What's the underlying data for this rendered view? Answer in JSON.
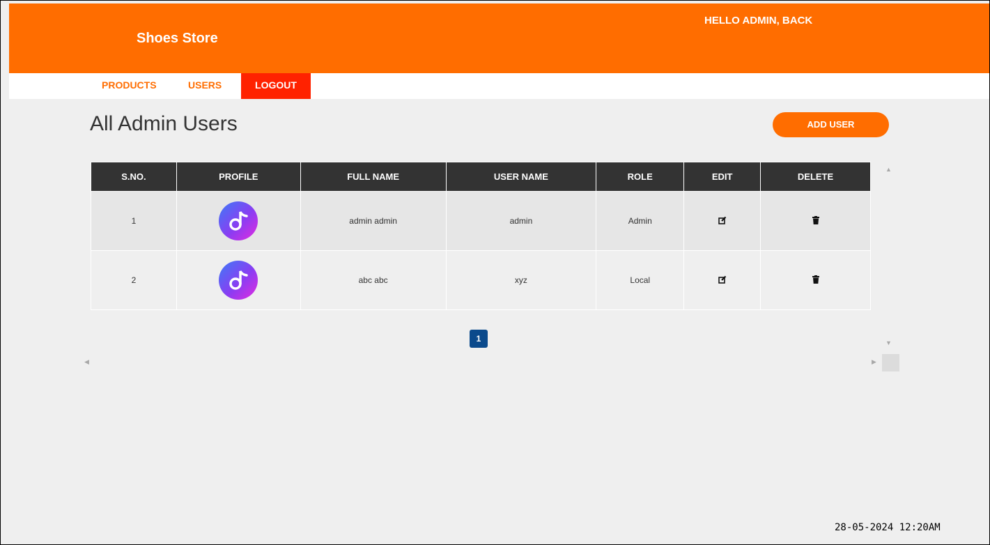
{
  "header": {
    "brand": "Shoes Store",
    "greeting": "HELLO ADMIN, BACK",
    "bg_color": "#ff6d00"
  },
  "nav": {
    "items": [
      {
        "label": "PRODUCTS",
        "active": false
      },
      {
        "label": "USERS",
        "active": false
      },
      {
        "label": "LOGOUT",
        "active": true
      }
    ],
    "accent_color": "#ff6d00",
    "logout_color": "#ff2200"
  },
  "page": {
    "title": "All Admin Users",
    "add_button": "ADD USER"
  },
  "table": {
    "columns": [
      "S.NO.",
      "PROFILE",
      "FULL NAME",
      "USER NAME",
      "ROLE",
      "EDIT",
      "DELETE"
    ],
    "rows": [
      {
        "sno": "1",
        "profile_icon": "music-note-avatar",
        "full_name": "admin admin",
        "user_name": "admin",
        "role": "Admin",
        "edit_icon": "edit-icon",
        "delete_icon": "trash-icon"
      },
      {
        "sno": "2",
        "profile_icon": "music-note-avatar",
        "full_name": "abc abc",
        "user_name": "xyz",
        "role": "Local",
        "edit_icon": "edit-icon",
        "delete_icon": "trash-icon"
      }
    ],
    "header_color": "#333333"
  },
  "pagination": {
    "current_page": "1",
    "color": "#0b4a8c"
  },
  "footer": {
    "timestamp": "28-05-2024 12:20AM"
  }
}
